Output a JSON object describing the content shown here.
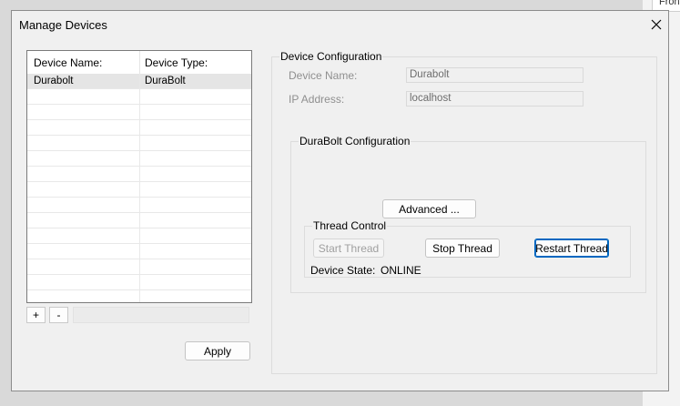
{
  "background": {
    "tab_text": "Fron"
  },
  "window": {
    "title": "Manage Devices"
  },
  "device_list": {
    "columns": [
      "Device Name:",
      "Device Type:"
    ],
    "rows": [
      {
        "name": "Durabolt",
        "type": "DuraBolt",
        "selected": true
      }
    ]
  },
  "list_controls": {
    "add_label": "+",
    "remove_label": "-"
  },
  "apply_label": "Apply",
  "device_configuration": {
    "group_label": "Device Configuration",
    "device_name_label": "Device Name:",
    "device_name_value": "Durabolt",
    "ip_label": "IP Address:",
    "ip_value": "localhost"
  },
  "durabolt_configuration": {
    "group_label": "DuraBolt Configuration",
    "advanced_label": "Advanced ..."
  },
  "thread_control": {
    "group_label": "Thread Control",
    "start_label": "Start Thread",
    "stop_label": "Stop Thread",
    "restart_label": "Restart Thread",
    "state_label": "Device State:",
    "state_value": "ONLINE"
  }
}
